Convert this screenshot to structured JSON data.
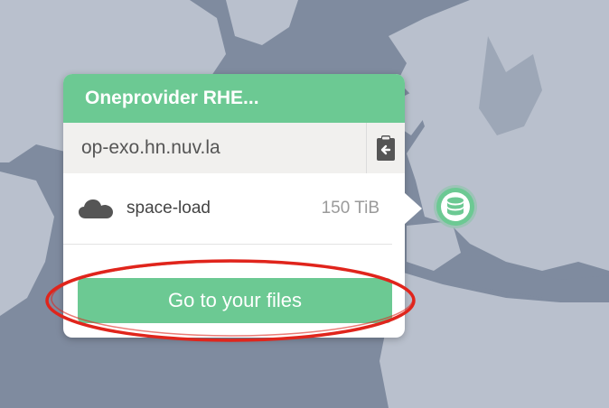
{
  "provider": {
    "name": "Oneprovider RHE...",
    "domain": "op-exo.hn.nuv.la"
  },
  "space": {
    "name": "space-load",
    "size": "150 TiB"
  },
  "actions": {
    "go_to_files": "Go to your files"
  },
  "icons": {
    "copy": "clipboard-copy-icon",
    "space": "cloud-icon",
    "marker": "database-icon"
  },
  "colors": {
    "accent": "#6cc993",
    "ocean": "#7f8b9f",
    "land": "#b9c0cd",
    "annotation": "#e0251c"
  }
}
